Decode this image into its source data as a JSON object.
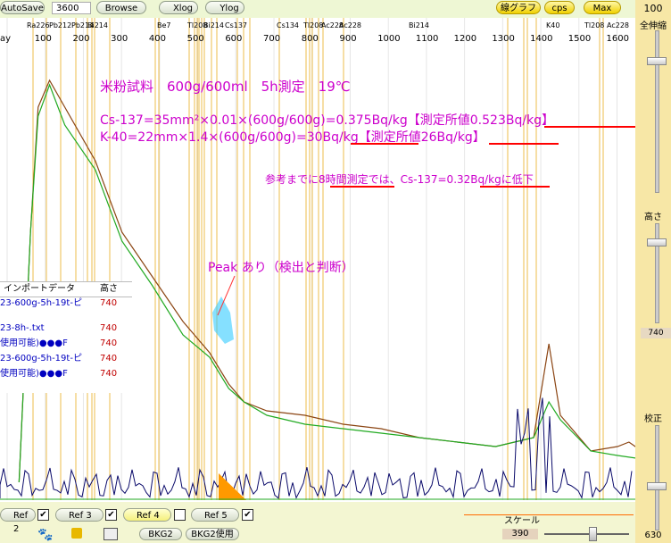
{
  "toolbar": {
    "autosave_label": "AutoSave",
    "count_value": "3600",
    "browse_label": "Browse",
    "xlog_label": "Xlog",
    "ylog_label": "Ylog",
    "graph_label": "線グラフ",
    "cps_label": "cps",
    "max_label": "Max"
  },
  "axis": {
    "ticks": [
      "ay",
      "100",
      "200",
      "300",
      "400",
      "500",
      "600",
      "700",
      "800",
      "900",
      "1000",
      "1100",
      "1200",
      "1300",
      "1400",
      "1500",
      "1600"
    ],
    "nuclides": [
      "Ra226",
      "Pb212",
      "Pb214",
      "Bi214",
      "Be7",
      "Tl208",
      "Bi214",
      "Cs137",
      "Cs134",
      "Tl208",
      "Ac228",
      "Ac228",
      "Bi214",
      "K40",
      "Tl208",
      "Ac228"
    ]
  },
  "annotation": {
    "line1": "米粉試料　600g/600ml　5h測定　19℃",
    "line2": "Cs-137=35mm²×0.01×(600g/600g)=0.375Bq/kg【測定所値0.523Bq/kg】",
    "line3": "K-40=22mm×1.4×(600g/600g)=30Bq/kg【測定所値26Bq/kg】",
    "line4": "参考までに8時間測定では、Cs-137=0.32Bq/kgに低下",
    "peak": "Peak あり（検出と判断）"
  },
  "import_table": {
    "header_name": "インポートデータ",
    "header_height": "高さ",
    "rows": [
      {
        "name": "23-600g-5h-19t-ピ",
        "height": "740"
      },
      {
        "name": "23-8h-.txt",
        "height": "740"
      },
      {
        "name": "使用可能)●●●F",
        "height": "740"
      },
      {
        "name": "23-600g-5h-19t-ピ",
        "height": "740"
      },
      {
        "name": "使用可能)●●●F",
        "height": "740"
      }
    ]
  },
  "right_panel": {
    "top_value": "100",
    "zenshin_label": "全伸縮",
    "takasa_label": "高さ",
    "takasa_value": "740",
    "kousei_label": "校正",
    "bottom_value": "630"
  },
  "bottom": {
    "refs": [
      "Ref 2",
      "Ref 3",
      "Ref 4",
      "Ref 5"
    ],
    "bkg2_label": "BKG2",
    "bkg2_use_label": "BKG2使用",
    "scale_label": "スケール",
    "scale_value": "390"
  },
  "chart_data": {
    "type": "line",
    "xlim": [
      0,
      1700
    ],
    "series": [
      {
        "values_desc": "measured",
        "points": [
          [
            50,
            20
          ],
          [
            80,
            300
          ],
          [
            100,
            440
          ],
          [
            130,
            470
          ],
          [
            170,
            440
          ],
          [
            250,
            380
          ],
          [
            320,
            300
          ],
          [
            400,
            250
          ],
          [
            480,
            200
          ],
          [
            550,
            165
          ],
          [
            600,
            130
          ],
          [
            640,
            110
          ],
          [
            700,
            100
          ],
          [
            800,
            95
          ],
          [
            900,
            85
          ],
          [
            1000,
            80
          ],
          [
            1100,
            70
          ],
          [
            1200,
            65
          ],
          [
            1300,
            60
          ],
          [
            1400,
            70
          ],
          [
            1440,
            175
          ],
          [
            1470,
            95
          ],
          [
            1550,
            55
          ],
          [
            1620,
            60
          ],
          [
            1650,
            65
          ],
          [
            1700,
            50
          ]
        ]
      },
      {
        "values_desc": "reference",
        "points": [
          [
            50,
            20
          ],
          [
            80,
            300
          ],
          [
            100,
            430
          ],
          [
            130,
            465
          ],
          [
            170,
            420
          ],
          [
            250,
            370
          ],
          [
            320,
            290
          ],
          [
            400,
            240
          ],
          [
            480,
            185
          ],
          [
            550,
            160
          ],
          [
            600,
            125
          ],
          [
            640,
            110
          ],
          [
            700,
            95
          ],
          [
            800,
            85
          ],
          [
            900,
            80
          ],
          [
            1000,
            75
          ],
          [
            1100,
            70
          ],
          [
            1200,
            65
          ],
          [
            1300,
            60
          ],
          [
            1400,
            70
          ],
          [
            1440,
            110
          ],
          [
            1470,
            90
          ],
          [
            1550,
            55
          ],
          [
            1620,
            50
          ],
          [
            1700,
            45
          ]
        ]
      }
    ]
  }
}
